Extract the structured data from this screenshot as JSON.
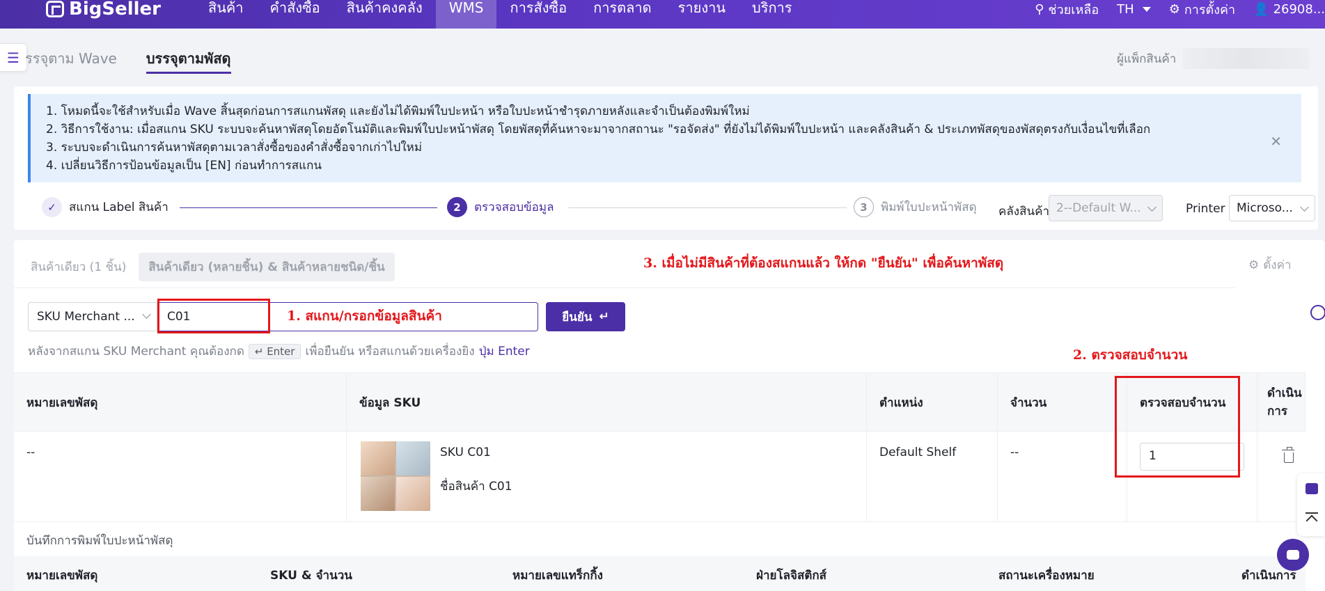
{
  "brand": "BigSeller",
  "nav": [
    "สินค้า",
    "คำสั่งซื้อ",
    "สินค้าคงคลัง",
    "WMS",
    "การสั่งซื้อ",
    "การตลาด",
    "รายงาน",
    "บริการ"
  ],
  "top_right": {
    "help": "ช่วยเหลือ",
    "lang": "TH",
    "settings": "การตั้งค่า",
    "user": "26908..."
  },
  "mode_tabs": [
    "รรจุตาม Wave",
    "บรรจุตามพัสดุ"
  ],
  "packer_label": "ผู้แพ็กสินค้า",
  "info_lines": [
    "1. โหมดนี้จะใช้สำหรับเมื่อ Wave สิ้นสุดก่อนการสแกนพัสดุ และยังไม่ได้พิมพ์ใบปะหน้า หรือใบปะหน้าชำรุดภายหลังและจำเป็นต้องพิมพ์ใหม่",
    "2. วิธีการใช้งาน: เมื่อสแกน SKU ระบบจะค้นหาพัสดุโดยอัตโนมัติและพิมพ์ใบปะหน้าพัสดุ โดยพัสดุที่ค้นหาจะมาจากสถานะ \"รอจัดส่ง\" ที่ยังไม่ได้พิมพ์ใบปะหน้า และคลังสินค้า & ประเภทพัสดุของพัสดุตรงกับเงื่อนไขที่เลือก",
    "3. ระบบจะดำเนินการค้นหาพัสดุตามเวลาสั่งซื้อของคำสั่งซื้อจากเก่าไปใหม่",
    "4. เปลี่ยนวิธีการป้อนข้อมูลเป็น [EN] ก่อนทำการสแกน"
  ],
  "steps": [
    {
      "num": "2",
      "label": "ตรวจสอบข้อมูล"
    },
    {
      "num": "3",
      "label": "พิมพ์ใบปะหน้าพัสดุ"
    }
  ],
  "step1_label": "สแกน Label สินค้า",
  "warehouse": {
    "label": "คลังสินค้า",
    "value": "2--Default W..."
  },
  "printer": {
    "label": "Printer",
    "value": "Microso..."
  },
  "sub_tabs": [
    "สินค้าเดียว (1 ชิ้น)",
    "สินค้าเดียว (หลายชิ้น) & สินค้าหลายชนิด/ชิ้น"
  ],
  "settings_label": "ตั้งค่า",
  "annotations": {
    "a1": "1. สแกน/กรอกข้อมูลสินค้า",
    "a2": "2. ตรวจสอบจำนวน",
    "a3": "3. เมื่อไม่มีสินค้าที่ต้องสแกนแล้ว ให้กด \"ยืนยัน\" เพื่อค้นหาพัสดุ"
  },
  "scan": {
    "type": "SKU Merchant ...",
    "value": "C01",
    "confirm": "ยืนยัน",
    "confirm_icon": "↵"
  },
  "hint": {
    "before": "หลังจากสแกน SKU Merchant คุณต้องกด",
    "key": "↵ Enter",
    "after": "เพื่อยืนยัน หรือสแกนด้วยเครื่องยิง",
    "link": "ปุ่ม Enter"
  },
  "table": {
    "headers": [
      "หมายเลขพัสดุ",
      "ข้อมูล SKU",
      "ตำแหน่ง",
      "จำนวน",
      "ตรวจสอบจำนวน",
      "ดำเนิน การ"
    ],
    "row": {
      "parcel": "--",
      "sku": "SKU C01",
      "name": "ชื่อสินค้า C01",
      "location": "Default Shelf",
      "qty": "--",
      "check_qty": "1"
    }
  },
  "log": {
    "title": "บันทึกการพิมพ์ใบปะหน้าพัสดุ",
    "headers": [
      "หมายเลขพัสดุ",
      "SKU & จำนวน",
      "หมายเลขแทร็กกิ้ง",
      "ฝ่ายโลจิสติกส์",
      "สถานะเครื่องหมาย",
      "ดำเนินการ"
    ]
  }
}
